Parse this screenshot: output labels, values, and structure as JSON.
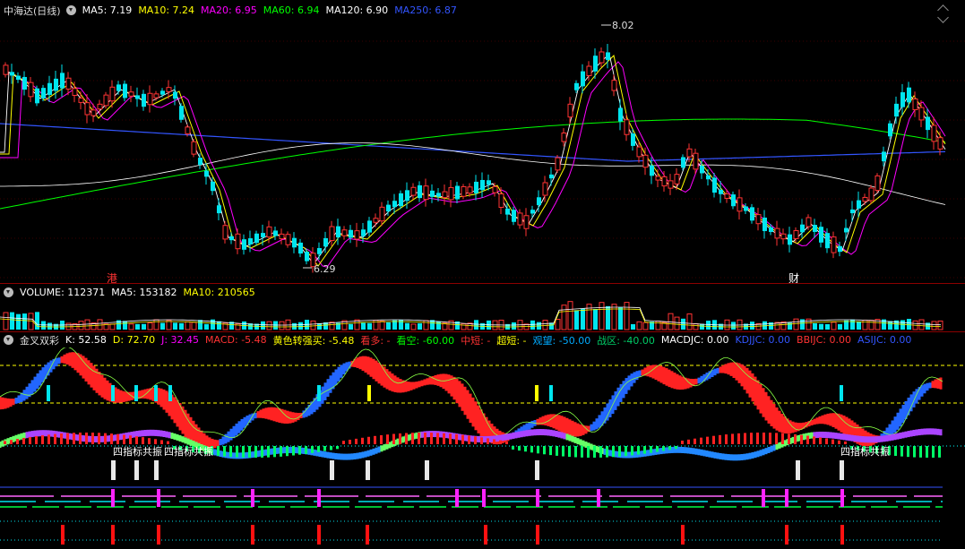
{
  "main": {
    "title": "中海达(日线)",
    "ma": [
      {
        "label": "MA5: 7.19",
        "color": "#ffffff"
      },
      {
        "label": "MA10: 7.24",
        "color": "#ffff00"
      },
      {
        "label": "MA20: 6.95",
        "color": "#ff00ff"
      },
      {
        "label": "MA60: 6.94",
        "color": "#00ff00"
      },
      {
        "label": "MA120: 6.90",
        "color": "#ffffff"
      },
      {
        "label": "MA250: 6.87",
        "color": "#3355ff"
      }
    ],
    "high_label": "8.02",
    "low_label": "6.29",
    "marker_gang": "港",
    "marker_cai": "财"
  },
  "volume": {
    "label": "VOLUME: 112371",
    "ma5": "MA5: 153182",
    "ma10": "MA10: 210565"
  },
  "indicator": {
    "name": "金叉双彩",
    "items": [
      {
        "label": "K: 52.58",
        "color": "#ffffff"
      },
      {
        "label": "D: 72.70",
        "color": "#ffff00"
      },
      {
        "label": "J: 32.45",
        "color": "#ff00ff"
      },
      {
        "label": "MACD: -5.48",
        "color": "#ff3333"
      },
      {
        "label": "黄色转强买: -5.48",
        "color": "#ffff00"
      },
      {
        "label": "看多: -",
        "color": "#ff3333"
      },
      {
        "label": "看空: -60.00",
        "color": "#00ff00"
      },
      {
        "label": "中短: -",
        "color": "#ff3333"
      },
      {
        "label": "超短: -",
        "color": "#ffff00"
      },
      {
        "label": "观望: -50.00",
        "color": "#00aaff"
      },
      {
        "label": "战区: -40.00",
        "color": "#00cc66"
      },
      {
        "label": "MACDJC: 0.00",
        "color": "#ffffff"
      },
      {
        "label": "KDJJC: 0.00",
        "color": "#3355ff"
      },
      {
        "label": "BBIJC: 0.00",
        "color": "#ff3333"
      },
      {
        "label": "ASIJC: 0.00",
        "color": "#3355ff"
      }
    ],
    "resonance_label": "四指标共振"
  },
  "colors": {
    "up": "#ff3333",
    "down": "#00e5ee",
    "bg": "#000000",
    "grid": "#8b0000"
  },
  "icons": {
    "dropdown": "chevron-down-icon",
    "scroll": "double-chevron-icon"
  }
}
